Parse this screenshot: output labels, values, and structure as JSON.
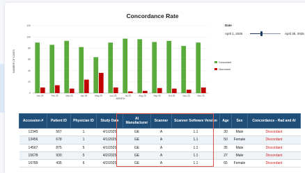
{
  "chart_data": {
    "type": "bar",
    "title": "Concordance Rate",
    "xlabel": "MONTH",
    "ylabel": "NUMBER OF CASES",
    "ylim": [
      0,
      120
    ],
    "yticks": [
      0,
      20,
      40,
      60,
      80,
      100,
      120
    ],
    "categories": [
      "Jan-25",
      "Feb-25",
      "Mar-25",
      "Apr-25",
      "May-25",
      "Jun-25",
      "Jul-25",
      "Aug-25",
      "Sep-25",
      "Oct-25",
      "Nov-25",
      "Dec-25"
    ],
    "series": [
      {
        "name": "Concordant",
        "color": "#5aab3c",
        "values": [
          90,
          86,
          93,
          82,
          64,
          90,
          97,
          96,
          91,
          93,
          84,
          90
        ]
      },
      {
        "name": "Discordant",
        "color": "#c00000",
        "values": [
          10,
          14,
          8,
          24,
          36,
          10,
          3,
          4,
          9,
          8,
          6,
          10
        ]
      }
    ],
    "grid": true,
    "legend": "right"
  },
  "colors": {
    "concordant": "#5aab3c",
    "discordant": "#c00000",
    "header": "#1f4e79",
    "highlight": "#d9534f"
  },
  "date_filter": {
    "title": "Date",
    "start": "April 1, 2025",
    "end": "April 30, 2025"
  },
  "table": {
    "headers": [
      "Accession #",
      "Patient ID",
      "Physician ID",
      "Study Date",
      "AI Manufacturer",
      "Scanner",
      "Scanner Software Version",
      "Age",
      "Sex",
      "Concordance - Rad and AI"
    ],
    "rows": [
      [
        "12345",
        "567",
        "1",
        "4/1/2025",
        "GE",
        "A",
        "1.1",
        "30",
        "Male",
        "Discordant"
      ],
      [
        "13456",
        "678",
        "1",
        "4/1/2025",
        "GE",
        "A",
        "1.1",
        "50",
        "Female",
        "Discordant"
      ],
      [
        "14567",
        "875",
        "5",
        "4/1/2025",
        "GE",
        "A",
        "1.1",
        "35",
        "Male",
        "Discordant"
      ],
      [
        "15678",
        "930",
        "5",
        "4/2/2025",
        "GE",
        "A",
        "1.1",
        "27",
        "Male",
        "Discordant"
      ],
      [
        "16789",
        "435",
        "6",
        "4/2/2025",
        "GE",
        "A",
        "1.1",
        "65",
        "Female",
        "Discordant"
      ]
    ]
  }
}
